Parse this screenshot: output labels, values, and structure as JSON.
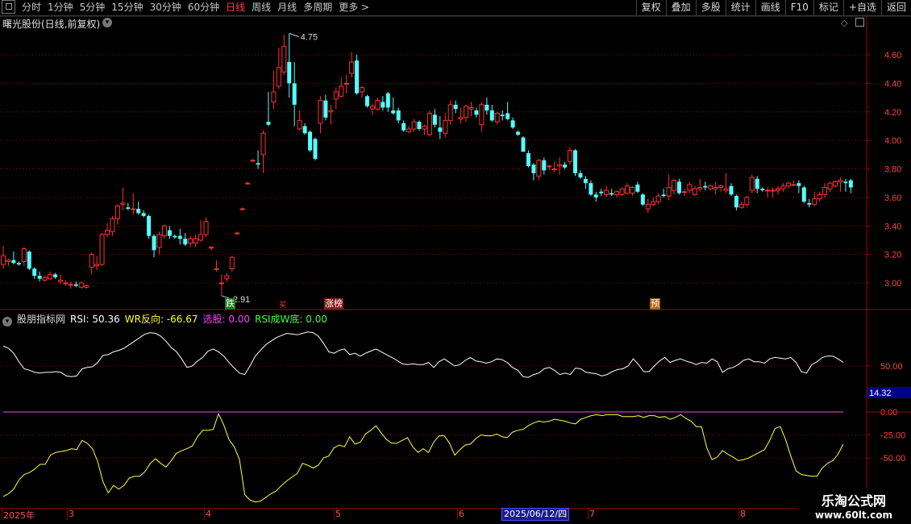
{
  "toolbar": {
    "periods": [
      "分时",
      "1分钟",
      "5分钟",
      "15分钟",
      "30分钟",
      "60分钟",
      "日线",
      "周线",
      "月线",
      "多周期",
      "更多 >"
    ],
    "active_period": "日线",
    "actions": [
      "复权",
      "叠加",
      "多股",
      "统计",
      "画线",
      "F10",
      "标记",
      "+自选",
      "返回"
    ]
  },
  "main_chart": {
    "title": "曙光股份(日线,前复权)",
    "y_ticks": [
      "4.60",
      "4.40",
      "4.20",
      "4.00",
      "3.80",
      "3.60",
      "3.40",
      "3.20",
      "3.00"
    ],
    "y_values": [
      4.6,
      4.4,
      4.2,
      4.0,
      3.8,
      3.6,
      3.4,
      3.2,
      3.0
    ],
    "high_label": "4.75",
    "low_label": "2.91",
    "tags": [
      "跌",
      "买",
      "涨榜",
      "预"
    ]
  },
  "indicator": {
    "name": "股朋指标网",
    "rsi_label": "RSI: 50.36",
    "wr_label": "WR反向: -66.67",
    "select_label": "选股: 0.00",
    "rsiw_label": "RSI成W底: 0.00",
    "y_ticks": [
      "50.00",
      "0.00",
      "-25.00",
      "-50.00"
    ],
    "cursor_value": "14.32"
  },
  "date_axis": {
    "labels": [
      "2025年",
      "3",
      "4",
      "5",
      "6",
      "7",
      "8"
    ],
    "selected_date": "2025/06/12/四"
  },
  "watermark": {
    "line1": "乐淘公式网",
    "line2": "www.60lt.com"
  },
  "colors": {
    "up": "#ff3030",
    "down": "#54ffff",
    "rsi": "#ffffff",
    "wr": "#ffff40",
    "grid": "#a00000"
  },
  "chart_data": {
    "type": "candlestick",
    "candles": [
      [
        3.13,
        3.26,
        3.1,
        3.19
      ],
      [
        3.15,
        3.17,
        3.12,
        3.16
      ],
      [
        3.16,
        3.22,
        3.13,
        3.14
      ],
      [
        3.14,
        3.15,
        3.12,
        3.13
      ],
      [
        3.15,
        3.25,
        3.12,
        3.24
      ],
      [
        3.22,
        3.23,
        3.09,
        3.1
      ],
      [
        3.1,
        3.11,
        3.03,
        3.05
      ],
      [
        3.05,
        3.08,
        3.01,
        3.03
      ],
      [
        3.02,
        3.05,
        3.01,
        3.04
      ],
      [
        3.03,
        3.08,
        3.02,
        3.06
      ],
      [
        3.06,
        3.07,
        3.03,
        3.04
      ],
      [
        3.01,
        3.06,
        2.99,
        3.02
      ],
      [
        3.0,
        3.02,
        2.98,
        3.0
      ],
      [
        2.99,
        3.01,
        2.96,
        2.99
      ],
      [
        2.99,
        3.01,
        2.97,
        2.98
      ],
      [
        2.97,
        3.01,
        2.96,
        3.0
      ],
      [
        2.97,
        2.99,
        2.96,
        2.98
      ],
      [
        3.11,
        3.21,
        3.06,
        3.2
      ],
      [
        3.12,
        3.19,
        3.09,
        3.13
      ],
      [
        3.13,
        3.35,
        3.12,
        3.34
      ],
      [
        3.34,
        3.42,
        3.32,
        3.37
      ],
      [
        3.36,
        3.47,
        3.33,
        3.45
      ],
      [
        3.45,
        3.55,
        3.41,
        3.54
      ],
      [
        3.55,
        3.67,
        3.51,
        3.56
      ],
      [
        3.53,
        3.56,
        3.51,
        3.52
      ],
      [
        3.52,
        3.63,
        3.48,
        3.52
      ],
      [
        3.52,
        3.57,
        3.48,
        3.49
      ],
      [
        3.49,
        3.51,
        3.46,
        3.47
      ],
      [
        3.47,
        3.48,
        3.31,
        3.33
      ],
      [
        3.33,
        3.34,
        3.18,
        3.23
      ],
      [
        3.25,
        3.36,
        3.2,
        3.34
      ],
      [
        3.33,
        3.41,
        3.31,
        3.4
      ],
      [
        3.37,
        3.4,
        3.31,
        3.33
      ],
      [
        3.33,
        3.34,
        3.31,
        3.32
      ],
      [
        3.33,
        3.38,
        3.27,
        3.31
      ],
      [
        3.31,
        3.35,
        3.26,
        3.27
      ],
      [
        3.28,
        3.33,
        3.25,
        3.31
      ],
      [
        3.28,
        3.34,
        3.25,
        3.31
      ],
      [
        3.3,
        3.44,
        3.29,
        3.34
      ],
      [
        3.34,
        3.46,
        3.32,
        3.43
      ],
      [
        3.25,
        3.26,
        3.23,
        3.25
      ],
      [
        3.1,
        3.16,
        3.08,
        3.1
      ],
      [
        3.0,
        3.06,
        2.91,
        3.0
      ],
      [
        3.03,
        3.07,
        3.01,
        3.05
      ],
      [
        3.1,
        3.19,
        3.08,
        3.18
      ],
      [
        3.35,
        3.36,
        3.34,
        3.35
      ],
      [
        3.52,
        3.53,
        3.51,
        3.52
      ],
      [
        3.7,
        3.71,
        3.69,
        3.7
      ],
      [
        3.86,
        3.87,
        3.85,
        3.86
      ],
      [
        3.84,
        3.93,
        3.8,
        3.83
      ],
      [
        3.9,
        4.07,
        3.77,
        4.05
      ],
      [
        4.13,
        4.34,
        4.1,
        4.11
      ],
      [
        4.27,
        4.49,
        4.22,
        4.34
      ],
      [
        4.38,
        4.65,
        4.36,
        4.51
      ],
      [
        4.48,
        4.74,
        4.46,
        4.66
      ],
      [
        4.55,
        4.75,
        4.3,
        4.4
      ],
      [
        4.4,
        4.55,
        4.1,
        4.25
      ],
      [
        4.08,
        4.21,
        4.07,
        4.14
      ],
      [
        4.1,
        4.12,
        4.04,
        4.05
      ],
      [
        4.06,
        4.07,
        3.92,
        3.93
      ],
      [
        4.01,
        4.02,
        3.86,
        3.87
      ],
      [
        4.12,
        4.31,
        4.05,
        4.28
      ],
      [
        4.28,
        4.32,
        4.14,
        4.16
      ],
      [
        4.2,
        4.25,
        4.11,
        4.21
      ],
      [
        4.29,
        4.37,
        4.22,
        4.34
      ],
      [
        4.31,
        4.44,
        4.3,
        4.38
      ],
      [
        4.4,
        4.46,
        4.33,
        4.4
      ],
      [
        4.47,
        4.62,
        4.44,
        4.55
      ],
      [
        4.56,
        4.6,
        4.32,
        4.33
      ],
      [
        4.34,
        4.38,
        4.3,
        4.37
      ],
      [
        4.31,
        4.32,
        4.23,
        4.24
      ],
      [
        4.22,
        4.26,
        4.18,
        4.24
      ],
      [
        4.22,
        4.3,
        4.21,
        4.28
      ],
      [
        4.27,
        4.31,
        4.21,
        4.23
      ],
      [
        4.33,
        4.34,
        4.2,
        4.23
      ],
      [
        4.21,
        4.3,
        4.18,
        4.19
      ],
      [
        4.21,
        4.23,
        4.12,
        4.14
      ],
      [
        4.12,
        4.14,
        4.06,
        4.07
      ],
      [
        4.06,
        4.1,
        4.05,
        4.08
      ],
      [
        4.08,
        4.15,
        4.06,
        4.13
      ],
      [
        4.13,
        4.14,
        4.07,
        4.08
      ],
      [
        4.08,
        4.11,
        4.04,
        4.1
      ],
      [
        4.04,
        4.21,
        4.03,
        4.19
      ],
      [
        4.18,
        4.22,
        4.09,
        4.11
      ],
      [
        4.09,
        4.17,
        4.01,
        4.06
      ],
      [
        4.05,
        4.19,
        4.02,
        4.14
      ],
      [
        4.14,
        4.28,
        4.11,
        4.25
      ],
      [
        4.25,
        4.28,
        4.19,
        4.22
      ],
      [
        4.15,
        4.23,
        4.12,
        4.16
      ],
      [
        4.16,
        4.25,
        4.13,
        4.24
      ],
      [
        4.22,
        4.27,
        4.17,
        4.23
      ],
      [
        4.21,
        4.23,
        4.16,
        4.18
      ],
      [
        4.11,
        4.27,
        4.06,
        4.25
      ],
      [
        4.25,
        4.3,
        4.18,
        4.21
      ],
      [
        4.21,
        4.25,
        4.13,
        4.14
      ],
      [
        4.13,
        4.2,
        4.11,
        4.19
      ],
      [
        4.18,
        4.21,
        4.14,
        4.17
      ],
      [
        4.19,
        4.27,
        4.14,
        4.15
      ],
      [
        4.14,
        4.16,
        4.08,
        4.09
      ],
      [
        4.06,
        4.07,
        4.03,
        4.04
      ],
      [
        4.02,
        4.03,
        3.92,
        3.92
      ],
      [
        3.91,
        3.93,
        3.81,
        3.82
      ],
      [
        3.83,
        3.84,
        3.72,
        3.77
      ],
      [
        3.75,
        3.87,
        3.72,
        3.86
      ],
      [
        3.86,
        3.88,
        3.76,
        3.79
      ],
      [
        3.82,
        3.83,
        3.79,
        3.82
      ],
      [
        3.8,
        3.85,
        3.78,
        3.8
      ],
      [
        3.82,
        3.88,
        3.76,
        3.83
      ],
      [
        3.83,
        3.85,
        3.8,
        3.81
      ],
      [
        3.85,
        3.95,
        3.83,
        3.93
      ],
      [
        3.93,
        3.94,
        3.75,
        3.77
      ],
      [
        3.77,
        3.79,
        3.73,
        3.74
      ],
      [
        3.73,
        3.75,
        3.66,
        3.7
      ],
      [
        3.7,
        3.72,
        3.61,
        3.62
      ],
      [
        3.62,
        3.64,
        3.57,
        3.6
      ],
      [
        3.64,
        3.66,
        3.61,
        3.63
      ],
      [
        3.62,
        3.68,
        3.6,
        3.65
      ],
      [
        3.63,
        3.66,
        3.61,
        3.62
      ],
      [
        3.62,
        3.65,
        3.6,
        3.64
      ],
      [
        3.62,
        3.67,
        3.61,
        3.66
      ],
      [
        3.63,
        3.7,
        3.62,
        3.68
      ],
      [
        3.63,
        3.68,
        3.61,
        3.67
      ],
      [
        3.69,
        3.71,
        3.63,
        3.64
      ],
      [
        3.62,
        3.63,
        3.54,
        3.55
      ],
      [
        3.52,
        3.59,
        3.49,
        3.55
      ],
      [
        3.55,
        3.6,
        3.54,
        3.57
      ],
      [
        3.57,
        3.63,
        3.55,
        3.61
      ],
      [
        3.62,
        3.66,
        3.6,
        3.61
      ],
      [
        3.61,
        3.76,
        3.58,
        3.67
      ],
      [
        3.65,
        3.73,
        3.62,
        3.72
      ],
      [
        3.71,
        3.73,
        3.62,
        3.63
      ],
      [
        3.64,
        3.66,
        3.61,
        3.64
      ],
      [
        3.65,
        3.71,
        3.63,
        3.69
      ],
      [
        3.62,
        3.68,
        3.61,
        3.66
      ],
      [
        3.66,
        3.73,
        3.64,
        3.67
      ],
      [
        3.68,
        3.71,
        3.65,
        3.67
      ],
      [
        3.66,
        3.69,
        3.65,
        3.68
      ],
      [
        3.66,
        3.71,
        3.62,
        3.67
      ],
      [
        3.67,
        3.69,
        3.64,
        3.68
      ],
      [
        3.65,
        3.77,
        3.63,
        3.66
      ],
      [
        3.68,
        3.7,
        3.61,
        3.62
      ],
      [
        3.61,
        3.62,
        3.51,
        3.53
      ],
      [
        3.53,
        3.57,
        3.52,
        3.55
      ],
      [
        3.55,
        3.61,
        3.53,
        3.6
      ],
      [
        3.65,
        3.76,
        3.63,
        3.74
      ],
      [
        3.73,
        3.75,
        3.63,
        3.66
      ],
      [
        3.66,
        3.67,
        3.64,
        3.65
      ],
      [
        3.65,
        3.67,
        3.6,
        3.65
      ],
      [
        3.65,
        3.67,
        3.6,
        3.65
      ],
      [
        3.65,
        3.68,
        3.62,
        3.66
      ],
      [
        3.66,
        3.7,
        3.64,
        3.68
      ],
      [
        3.68,
        3.71,
        3.66,
        3.7
      ],
      [
        3.69,
        3.72,
        3.68,
        3.69
      ],
      [
        3.7,
        3.72,
        3.63,
        3.68
      ],
      [
        3.67,
        3.68,
        3.56,
        3.57
      ],
      [
        3.56,
        3.59,
        3.53,
        3.55
      ],
      [
        3.55,
        3.64,
        3.54,
        3.59
      ],
      [
        3.59,
        3.64,
        3.57,
        3.62
      ],
      [
        3.62,
        3.7,
        3.6,
        3.67
      ],
      [
        3.66,
        3.71,
        3.64,
        3.7
      ],
      [
        3.68,
        3.72,
        3.67,
        3.71
      ],
      [
        3.71,
        3.74,
        3.64,
        3.72
      ],
      [
        3.71,
        3.73,
        3.64,
        3.7
      ],
      [
        3.72,
        3.73,
        3.63,
        3.67
      ]
    ],
    "rsi": [
      78,
      75,
      68,
      56,
      46,
      44,
      41,
      40,
      41,
      41,
      42,
      41,
      36,
      35,
      36,
      46,
      48,
      49,
      55,
      65,
      66,
      70,
      72,
      75,
      80,
      85,
      90,
      95,
      97,
      96,
      92,
      85,
      76,
      70,
      60,
      48,
      50,
      57,
      62,
      71,
      74,
      70,
      64,
      55,
      47,
      40,
      38,
      50,
      64,
      72,
      80,
      85,
      90,
      93,
      96,
      95,
      94,
      96,
      98,
      97,
      92,
      82,
      70,
      68,
      72,
      74,
      66,
      68,
      64,
      68,
      71,
      74,
      70,
      66,
      62,
      58,
      53,
      52,
      53,
      52,
      52,
      55,
      48,
      56,
      60,
      55,
      50,
      52,
      58,
      62,
      57,
      56,
      54,
      56,
      60,
      59,
      55,
      48,
      44,
      35,
      34,
      38,
      40,
      46,
      48,
      44,
      38,
      40,
      38,
      47,
      46,
      41,
      40,
      39,
      36,
      38,
      42,
      45,
      46,
      50,
      60,
      52,
      42,
      42,
      50,
      57,
      62,
      55,
      58,
      60,
      57,
      55,
      52,
      55,
      54,
      60,
      56,
      41,
      46,
      48,
      52,
      58,
      60,
      56,
      56,
      54,
      60,
      62,
      61,
      60,
      62,
      55,
      42,
      40,
      52,
      56,
      62,
      64,
      64,
      60,
      55
    ],
    "wr": [
      -92,
      -89,
      -84,
      -74,
      -68,
      -66,
      -62,
      -57,
      -57,
      -47,
      -44,
      -43,
      -42,
      -40,
      -41,
      -31,
      -34,
      -40,
      -54,
      -76,
      -88,
      -80,
      -84,
      -80,
      -72,
      -70,
      -70,
      -65,
      -56,
      -51,
      -56,
      -60,
      -53,
      -45,
      -42,
      -40,
      -37,
      -27,
      -20,
      -20,
      -19,
      -2,
      -14,
      -30,
      -38,
      -52,
      -90,
      -96,
      -98,
      -97,
      -93,
      -89,
      -86,
      -80,
      -75,
      -71,
      -67,
      -56,
      -58,
      -61,
      -58,
      -50,
      -48,
      -39,
      -36,
      -38,
      -27,
      -35,
      -33,
      -24,
      -20,
      -15,
      -23,
      -30,
      -34,
      -34,
      -31,
      -28,
      -38,
      -44,
      -40,
      -44,
      -33,
      -26,
      -26,
      -34,
      -47,
      -41,
      -36,
      -35,
      -29,
      -25,
      -26,
      -26,
      -24,
      -27,
      -28,
      -22,
      -20,
      -19,
      -15,
      -12,
      -10,
      -11,
      -10,
      -8,
      -9,
      -10,
      -12,
      -13,
      -8,
      -6,
      -4,
      -3,
      -4,
      -3,
      -3,
      -3,
      -5,
      -5,
      -5,
      -4,
      -6,
      -4,
      -4,
      -6,
      -5,
      -8,
      -6,
      -3,
      -7,
      -10,
      -16,
      -16,
      -39,
      -52,
      -49,
      -42,
      -46,
      -49,
      -53,
      -52,
      -50,
      -47,
      -44,
      -41,
      -31,
      -18,
      -16,
      -30,
      -48,
      -64,
      -68,
      -69,
      -70,
      -70,
      -61,
      -56,
      -53,
      -46,
      -35
    ]
  }
}
